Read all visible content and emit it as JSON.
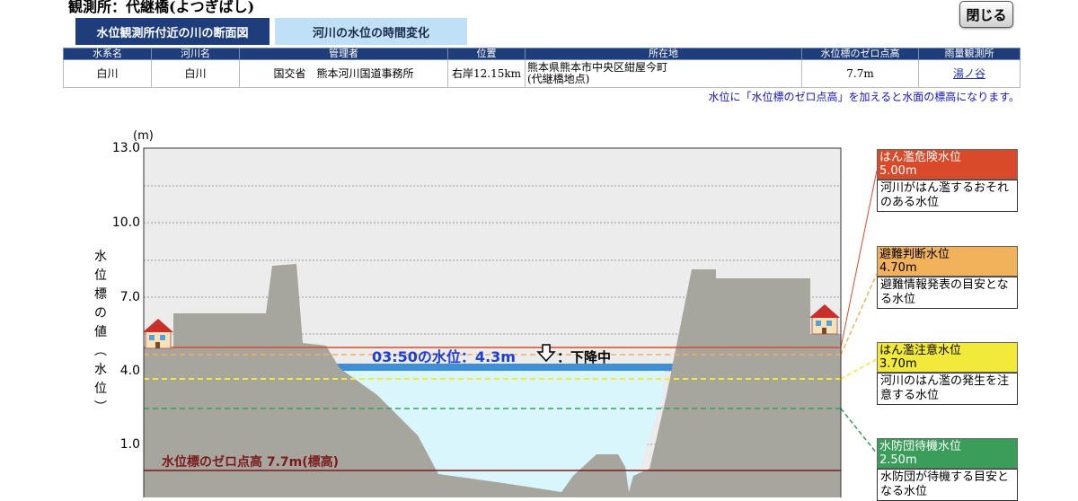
{
  "header": {
    "title": "観測所：代継橋(よつぎばし)",
    "close_label": "閉じる"
  },
  "tabs": [
    {
      "label": "水位観測所付近の川の断面図",
      "active": true
    },
    {
      "label": "河川の水位の時間変化",
      "active": false
    }
  ],
  "info_table": {
    "headers": [
      "水系名",
      "河川名",
      "管理者",
      "位置",
      "所在地",
      "水位標のゼロ点高",
      "雨量観測所"
    ],
    "row": {
      "system": "白川",
      "river": "白川",
      "manager": "国交省　熊本河川国道事務所",
      "position": "右岸12.15km",
      "address_line1": "熊本県熊本市中央区紺屋今町",
      "address_line2": "(代継橋地点)",
      "zero_height": "7.7m",
      "rain_station": "湯ノ谷"
    }
  },
  "note": "水位に「水位標のゼロ点高」を加えると水面の標高になります。",
  "chart": {
    "unit": "(m)",
    "y_ticks": [
      "13.0",
      "10.0",
      "7.0",
      "4.0",
      "1.0"
    ],
    "y_axis_label_chars": [
      "水",
      "位",
      "標",
      "の",
      "値",
      "︵",
      "水",
      "位",
      "︶"
    ],
    "current_level_text": "03:50の水位：4.3m",
    "trend_text": "：下降中",
    "zero_point_text": "水位標のゼロ点高 7.7m(標高)",
    "current_level": 4.3,
    "colors": {
      "water": "#d8f6fb",
      "water_surface": "#3f8fd6",
      "ground": "#a6a59e",
      "chart_bg": "#ececec",
      "danger": "#d94a2b",
      "evacuation": "#f2b25c",
      "caution": "#f2ea3a",
      "standby": "#3a9e5a",
      "zero_line": "#7a1a1a"
    }
  },
  "thresholds": [
    {
      "name": "はん濫危険水位",
      "value": "5.00m",
      "desc": "河川がはん濫するおそれのある水位",
      "color": "#d94a2b"
    },
    {
      "name": "避難判断水位",
      "value": "4.70m",
      "desc": "避難情報発表の目安となる水位",
      "color": "#f2b25c"
    },
    {
      "name": "はん濫注意水位",
      "value": "3.70m",
      "desc": "河川のはん濫の発生を注意する水位",
      "color": "#f2ea3a"
    },
    {
      "name": "水防団待機水位",
      "value": "2.50m",
      "desc": "水防団が待機する目安となる水位",
      "color": "#3a9e5a"
    }
  ]
}
